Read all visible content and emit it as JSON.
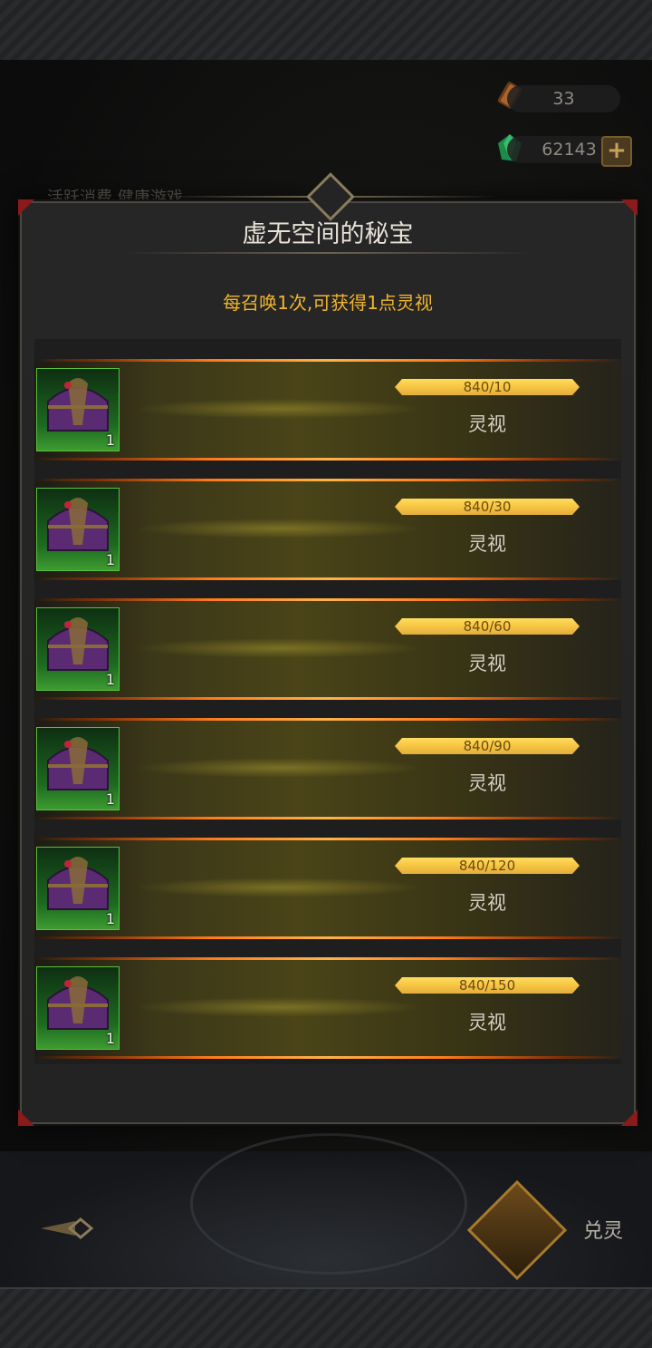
{
  "currencies": {
    "scroll": {
      "icon": "scroll-icon",
      "value": "33"
    },
    "gem": {
      "icon": "green-gem-icon",
      "value": "62143"
    }
  },
  "background": {
    "tabs_partial": "活跃消费  健康游戏",
    "redeem_label": "兑灵"
  },
  "modal": {
    "title": "虚无空间的秘宝",
    "subtitle": "每召唤1次,可获得1点灵视",
    "rows": [
      {
        "chest_qty": "1",
        "progress_text": "840/10",
        "progress": 1.0,
        "reward_label": "灵视"
      },
      {
        "chest_qty": "1",
        "progress_text": "840/30",
        "progress": 1.0,
        "reward_label": "灵视"
      },
      {
        "chest_qty": "1",
        "progress_text": "840/60",
        "progress": 1.0,
        "reward_label": "灵视"
      },
      {
        "chest_qty": "1",
        "progress_text": "840/90",
        "progress": 1.0,
        "reward_label": "灵视"
      },
      {
        "chest_qty": "1",
        "progress_text": "840/120",
        "progress": 1.0,
        "reward_label": "灵视"
      },
      {
        "chest_qty": "1",
        "progress_text": "840/150",
        "progress": 1.0,
        "reward_label": "灵视"
      }
    ]
  },
  "colors": {
    "accent_gold": "#f2b52b",
    "glow_orange": "#ff7a1a",
    "frame_red": "#8b1a1a"
  }
}
